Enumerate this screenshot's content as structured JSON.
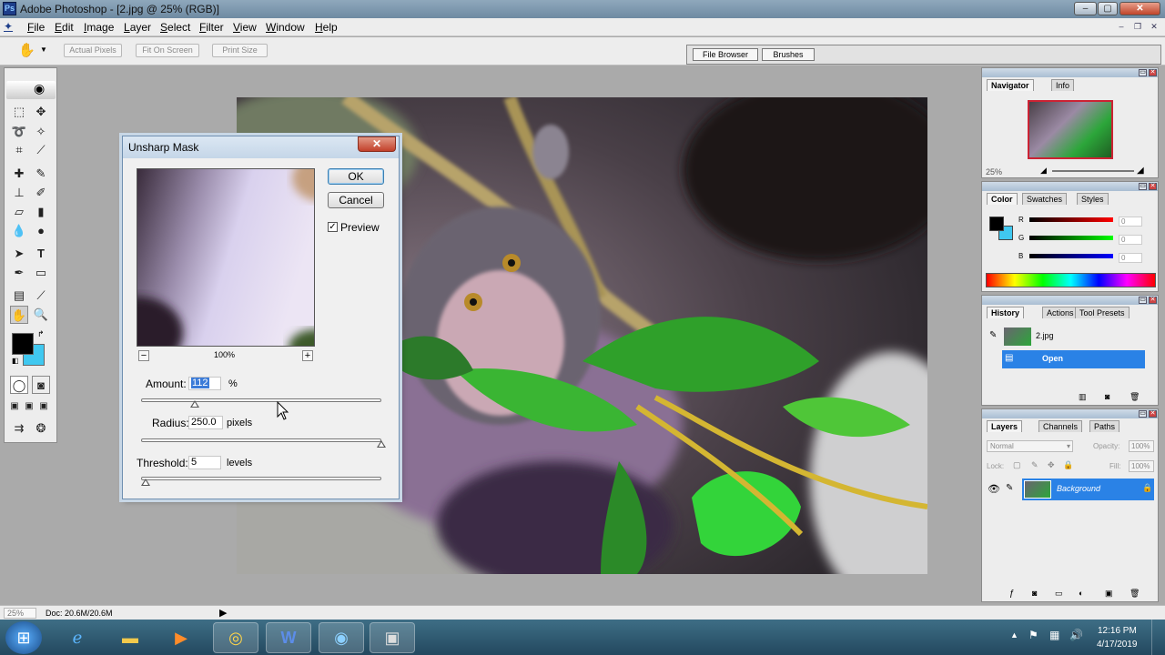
{
  "window": {
    "title": "Adobe Photoshop - [2.jpg @ 25% (RGB)]"
  },
  "menu": [
    "File",
    "Edit",
    "Image",
    "Layer",
    "Select",
    "Filter",
    "View",
    "Window",
    "Help"
  ],
  "options": {
    "actual_pixels": "Actual Pixels",
    "fit_on_screen": "Fit On Screen",
    "print_size": "Print Size"
  },
  "well_tabs": [
    "File Browser",
    "Brushes"
  ],
  "dialog": {
    "title": "Unsharp Mask",
    "ok": "OK",
    "cancel": "Cancel",
    "preview_label": "Preview",
    "preview_checked": true,
    "zoom": "100%",
    "amount_label": "Amount:",
    "amount_value": "112",
    "amount_unit": "%",
    "radius_label": "Radius:",
    "radius_value": "250.0",
    "radius_unit": "pixels",
    "threshold_label": "Threshold:",
    "threshold_value": "5",
    "threshold_unit": "levels",
    "amount_fraction": 0.224,
    "radius_fraction": 1.0,
    "threshold_fraction": 0.02
  },
  "navigator": {
    "tabs": [
      "Navigator",
      "Info"
    ],
    "zoom": "25%"
  },
  "color": {
    "tabs": [
      "Color",
      "Swatches",
      "Styles"
    ],
    "channels": [
      {
        "label": "R",
        "value": "0",
        "color": "#d00000"
      },
      {
        "label": "G",
        "value": "0",
        "color": "#00b000"
      },
      {
        "label": "B",
        "value": "0",
        "color": "#0000d0"
      }
    ],
    "foreground": "#000000",
    "background": "#40c8f0"
  },
  "history": {
    "tabs": [
      "History",
      "Actions",
      "Tool Presets"
    ],
    "snapshot": "2.jpg",
    "state": "Open"
  },
  "layers": {
    "tabs": [
      "Layers",
      "Channels",
      "Paths"
    ],
    "blend_mode": "Normal",
    "opacity_label": "Opacity:",
    "opacity": "100%",
    "lock_label": "Lock:",
    "fill_label": "Fill:",
    "fill": "100%",
    "layer_name": "Background"
  },
  "status": {
    "zoom": "25%",
    "doc": "Doc: 20.6M/20.6M"
  },
  "taskbar": {
    "time": "12:16 PM",
    "date": "4/17/2019"
  }
}
